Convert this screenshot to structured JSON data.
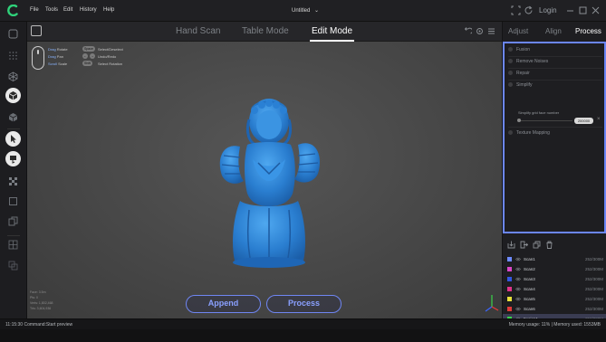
{
  "menu": {
    "items": [
      "File",
      "Tools",
      "Edit",
      "History",
      "Help"
    ],
    "document_title": "Untitled",
    "login_label": "Login"
  },
  "mode_tabs": [
    {
      "label": "Hand Scan",
      "active": false
    },
    {
      "label": "Table Mode",
      "active": false
    },
    {
      "label": "Edit Mode",
      "active": true
    }
  ],
  "mouse_hints": {
    "drag_rotate": {
      "key": "Drag",
      "action": "Rotate"
    },
    "drag_pan": {
      "key": "Drag",
      "action": "Pan"
    },
    "scroll_scale": {
      "key": "Scroll",
      "action": "Scale"
    },
    "kbd_hint_1": {
      "key": "Space",
      "action": "Select/Deselect"
    },
    "kbd_hint_2": {
      "action": "Undo/Redo"
    },
    "kbd_hint_3": {
      "key": "Shift",
      "action": "Select Rotation"
    }
  },
  "viewport_info": {
    "line1": "Face: 3.5m",
    "line2": "Pts: 0",
    "line3": "Verts: 1,802,468",
    "line4": "Tris: 3,604,936"
  },
  "actions": {
    "append_label": "Append",
    "process_label": "Process"
  },
  "right_panel": {
    "tabs": [
      {
        "label": "Adjust",
        "active": false
      },
      {
        "label": "Align",
        "active": false
      },
      {
        "label": "Process",
        "active": true
      }
    ],
    "process_steps": [
      "Fusion",
      "Remove Noises",
      "Repair",
      "Simplify",
      "Texture Mapping"
    ],
    "simplify_label": "Simplify grid face number",
    "simplify_value": "200000"
  },
  "scans": [
    {
      "name": "Scan1",
      "size": "252/300M",
      "color": "#6e8bff"
    },
    {
      "name": "Scan2",
      "size": "252/300M",
      "color": "#d946c6"
    },
    {
      "name": "Scan3",
      "size": "252/300M",
      "color": "#3457e0"
    },
    {
      "name": "Scan4",
      "size": "252/300M",
      "color": "#e0348a"
    },
    {
      "name": "Scan5",
      "size": "252/300M",
      "color": "#e8e03a"
    },
    {
      "name": "Scan6",
      "size": "252/300M",
      "color": "#e03a3a"
    },
    {
      "name": "Fusion1",
      "size": "252/300M",
      "color": "#3ad64b",
      "selected": true
    }
  ],
  "status": {
    "left": "11:15:30 Command:Start preview",
    "right": "Memory usage: 11%  |  Memory used: 1553MB"
  },
  "colors": {
    "accent": "#6b86f6",
    "model": "#2f8ad6"
  }
}
